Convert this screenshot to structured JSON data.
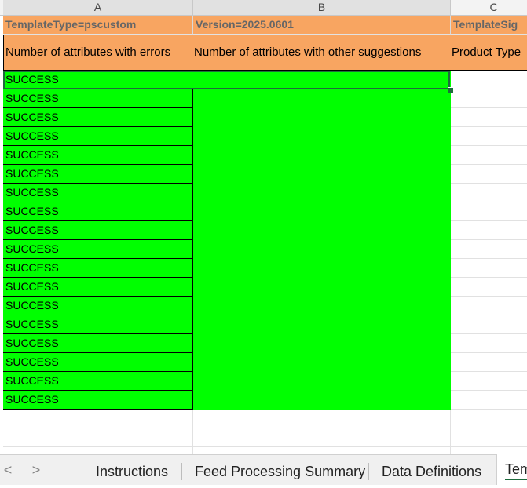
{
  "columns": {
    "a": "A",
    "b": "B",
    "c": "C"
  },
  "row1": {
    "a": "TemplateType=pscustom",
    "b": "Version=2025.0601",
    "c": "TemplateSig"
  },
  "row2": {
    "a": "Number of attributes with errors",
    "b": "Number of attributes with other suggestions",
    "c": "Product Type"
  },
  "status_rows": [
    "SUCCESS",
    "SUCCESS",
    "SUCCESS",
    "SUCCESS",
    "SUCCESS",
    "SUCCESS",
    "SUCCESS",
    "SUCCESS",
    "SUCCESS",
    "SUCCESS",
    "SUCCESS",
    "SUCCESS",
    "SUCCESS",
    "SUCCESS",
    "SUCCESS",
    "SUCCESS",
    "SUCCESS",
    "SUCCESS"
  ],
  "tabs": {
    "prev": "<",
    "next": ">",
    "items": [
      "Instructions",
      "Feed Processing Summary",
      "Data Definitions",
      "Tem"
    ]
  },
  "colors": {
    "header_fill": "#f8a561",
    "success_fill": "#00ff00",
    "selection": "#1e6b3d"
  }
}
